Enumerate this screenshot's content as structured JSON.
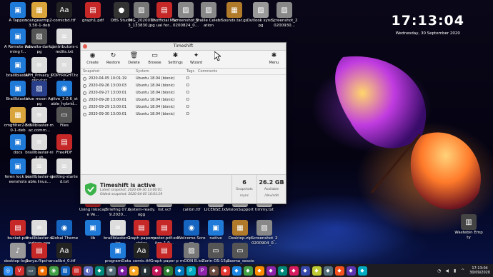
{
  "clock": {
    "time": "17:13:04",
    "date": "Wednesday, 30 September 2020"
  },
  "desktop_icons": [
    {
      "label": "A Tappon",
      "color": "#1f7ad8",
      "glyph": "▣"
    },
    {
      "label": "scangearmp2-3.50-1-deb",
      "color": "#d9a43c",
      "glyph": "▦"
    },
    {
      "label": "comicbd.ttf",
      "color": "#222",
      "glyph": "Aa"
    },
    {
      "label": "graph1.pdf",
      "color": "#c62828",
      "glyph": "▤"
    },
    {
      "label": "OBS Studio",
      "color": "#333",
      "glyph": "●"
    },
    {
      "label": "IMG_20200703_133830.jpg",
      "color": "#777",
      "glyph": "▨"
    },
    {
      "label": "Unofficial Manual for...",
      "color": "#c62828",
      "glyph": "▤"
    },
    {
      "label": "Screenshot_20200824_0...",
      "color": "#888",
      "glyph": "▨"
    },
    {
      "label": "Braille Celebration",
      "color": "#888",
      "glyph": "▨"
    },
    {
      "label": "Sounds.tar.gz",
      "color": "#b07a2a",
      "glyph": "▦"
    },
    {
      "label": "Outlook sync.jpg",
      "color": "#999",
      "glyph": "▨"
    },
    {
      "label": "Screenshot_20200930...",
      "color": "#888",
      "glyph": "▨"
    },
    {
      "label": "A Remote Learning f...",
      "color": "#1f7ad8",
      "glyph": "▣"
    },
    {
      "label": "Adwaita-dark.jpg",
      "color": "#555",
      "glyph": "▨"
    },
    {
      "label": "contributors-credits.txt",
      "color": "#ddd",
      "glyph": "≡"
    },
    {
      "label": "braillblaster",
      "color": "#1f7ad8",
      "glyph": "▣"
    },
    {
      "label": "APH_Privacy_Policy.txt",
      "color": "#ddd",
      "glyph": "≡"
    },
    {
      "label": "COPYRIGHT.txt",
      "color": "#ddd",
      "glyph": "≡"
    },
    {
      "label": "Braillblaster",
      "color": "#1f7ad8",
      "glyph": "▣"
    },
    {
      "label": "blue moon A.jpg",
      "color": "#2a3f8a",
      "glyph": "▨"
    },
    {
      "label": "elive_3.0.6_stable_hybrid...",
      "color": "#1f7ad8",
      "glyph": "◉"
    },
    {
      "label": "cmgfilter2-5.50-1-deb",
      "color": "#d9a43c",
      "glyph": "▦"
    },
    {
      "label": "braillblaster-mac.comm...",
      "color": "#ddd",
      "glyph": "≡"
    },
    {
      "label": "Files",
      "color": "#555",
      "glyph": "▭"
    },
    {
      "label": "docs",
      "color": "#1f7ad8",
      "glyph": "▣"
    },
    {
      "label": "braillblaster-nix.sh",
      "color": "#ddd",
      "glyph": "≡"
    },
    {
      "label": "FreePDF",
      "color": "#c62828",
      "glyph": "▤"
    },
    {
      "label": "feren lock screenshots",
      "color": "#1f7ad8",
      "glyph": "▣"
    },
    {
      "label": "braillblaster-stable.linux...",
      "color": "#ddd",
      "glyph": "≡"
    },
    {
      "label": "getting-started.txt",
      "color": "#ddd",
      "glyph": "≡"
    },
    {
      "label": "bucket.pdf",
      "color": "#c62828",
      "glyph": "▤"
    },
    {
      "label": "braillblaster-windows.exe",
      "color": "#ddd",
      "glyph": "≡"
    },
    {
      "label": "Global Theme",
      "color": "#1565c0",
      "glyph": "◉"
    },
    {
      "label": "lib",
      "color": "#1f7ad8",
      "glyph": "▣"
    },
    {
      "label": "braillblaster-1.jar",
      "color": "#ddd",
      "glyph": "≡"
    },
    {
      "label": "Graph paper printer",
      "color": "#c62828",
      "glyph": "▤"
    },
    {
      "label": "master-pdf-editor_1.9...",
      "color": "#c62828",
      "glyph": "▤"
    },
    {
      "label": "Welcome Screen",
      "color": "#1565c0",
      "glyph": "◉"
    },
    {
      "label": "native",
      "color": "#1f7ad8",
      "glyph": "▣"
    },
    {
      "label": "Desktop.zip",
      "color": "#b07a2a",
      "glyph": "▦"
    },
    {
      "label": "Screenshot_20200904_0...",
      "color": "#888",
      "glyph": "▨"
    },
    {
      "label": "desktop-login.ogg",
      "color": "#999",
      "glyph": "♪"
    },
    {
      "label": "Surya.flipchart",
      "color": "#c62828",
      "glyph": "▤"
    },
    {
      "label": "calibri_0.ttf",
      "color": "#222",
      "glyph": "Aa"
    },
    {
      "label": "Wastebin Empty",
      "color": "#444",
      "glyph": "▥"
    },
    {
      "label": "programData",
      "color": "#1f7ad8",
      "glyph": "▣"
    },
    {
      "label": "comic.ttf",
      "color": "#222",
      "glyph": "Aa"
    },
    {
      "label": "Graph paper printer link",
      "color": "#c62828",
      "glyph": "▤"
    },
    {
      "label": "mOON B.icf",
      "color": "#777",
      "glyph": "▨"
    },
    {
      "label": "Zorin-OS-15.2-Co...",
      "color": "#555",
      "glyph": "▭"
    },
    {
      "label": "plasma_session-20200828...",
      "color": "#555",
      "glyph": "▭"
    },
    {
      "label": "Using Inkscape Ve...",
      "color": "#c62828",
      "glyph": "▤"
    },
    {
      "label": "Briefing 07.09.2020...",
      "color": "#999",
      "glyph": "♪"
    },
    {
      "label": "system-ready.ogg",
      "color": "#999",
      "glyph": "♪"
    },
    {
      "label": "list.vcf",
      "color": "#ddd",
      "glyph": "≡"
    },
    {
      "label": "calibri.ttf",
      "color": "#222",
      "glyph": "Aa"
    },
    {
      "label": "LICENSE.txt",
      "color": "#ddd",
      "glyph": "≡"
    },
    {
      "label": "VisionSupport",
      "color": "#ddd",
      "glyph": "≡"
    },
    {
      "label": "timmy.txt",
      "color": "#ddd",
      "glyph": "≡"
    },
    {
      "label": "THE BIG GEOGRAPH...",
      "color": "#c62828",
      "glyph": "▤"
    },
    {
      "label": "Screenshot_20200904_0...",
      "color": "#888",
      "glyph": "▨"
    },
    {
      "label": "desktop-login.ogg",
      "color": "#999",
      "glyph": "♪"
    },
    {
      "label": "Screenshot_20200923_1...",
      "color": "#888",
      "glyph": "▨"
    },
    {
      "label": "calibri.ttf",
      "color": "#222",
      "glyph": "Aa"
    }
  ],
  "window": {
    "title": "Timeshift",
    "toolbar": [
      {
        "label": "Create",
        "icon": "create-icon",
        "glyph": "◉"
      },
      {
        "label": "Restore",
        "icon": "restore-icon",
        "glyph": "↻"
      },
      {
        "label": "Delete",
        "icon": "delete-icon",
        "glyph": "🗑"
      },
      {
        "label": "Browse",
        "icon": "folder-icon",
        "glyph": "▭"
      },
      {
        "label": "Settings",
        "icon": "settings-icon",
        "glyph": "✱"
      },
      {
        "label": "Wizard",
        "icon": "wizard-icon",
        "glyph": "✦"
      }
    ],
    "menu_label": "Menu",
    "columns": {
      "snapshot": "Snapshot",
      "system": "System",
      "tags": "Tags",
      "comments": "Comments"
    },
    "snapshots": [
      {
        "date": "2020-04-05 10:01:19",
        "system": "Ubuntu 18.04 (bionic)",
        "tags": "D"
      },
      {
        "date": "2020-09-26 13:00:03",
        "system": "Ubuntu 18.04 (bionic)",
        "tags": "D"
      },
      {
        "date": "2020-09-27 13:00:01",
        "system": "Ubuntu 18.04 (bionic)",
        "tags": "D"
      },
      {
        "date": "2020-09-28 13:00:01",
        "system": "Ubuntu 18.04 (bionic)",
        "tags": "D"
      },
      {
        "date": "2020-09-29 13:00:01",
        "system": "Ubuntu 18.04 (bionic)",
        "tags": "D"
      },
      {
        "date": "2020-09-30 13:00:01",
        "system": "Ubuntu 18.04 (bionic)",
        "tags": "D"
      }
    ],
    "status": {
      "heading": "Timeshift is active",
      "latest": "Latest snapshot: 2020-09-30 13:00:01",
      "oldest": "Oldest snapshot: 2020-04-05 10:01:19",
      "count": "6",
      "count_label": "Snapshots",
      "count_sub": "rsync",
      "size": "26.2 GB",
      "size_label": "Available",
      "size_sub": "/dev/sdd"
    }
  },
  "taskbar": {
    "time": "17:13:04",
    "date": "30/09/2020",
    "apps": [
      {
        "name": "menu-icon",
        "color": "#2d8cf0",
        "glyph": "◎"
      },
      {
        "name": "vivaldi-icon",
        "color": "#d32f2f",
        "glyph": "V"
      },
      {
        "name": "files-icon",
        "color": "#455a64",
        "glyph": "▭"
      },
      {
        "name": "firefox-icon",
        "color": "#ef6c00",
        "glyph": "◉"
      },
      {
        "name": "chrome-icon",
        "color": "#43a047",
        "glyph": "◉"
      },
      {
        "name": "image-viewer-icon",
        "color": "#1565c0",
        "glyph": "▨"
      },
      {
        "name": "pdf-icon",
        "color": "#c62828",
        "glyph": "▤"
      },
      {
        "name": "discord-icon",
        "color": "#5c6bc0",
        "glyph": "◐"
      },
      {
        "name": "app-icon",
        "color": "#00897b",
        "glyph": "◆"
      },
      {
        "name": "settings-icon",
        "color": "#546e7a",
        "glyph": "✱"
      },
      {
        "name": "app-icon",
        "color": "#7b1fa2",
        "glyph": "◆"
      },
      {
        "name": "app-icon",
        "color": "#f9a825",
        "glyph": "◆"
      },
      {
        "name": "terminal-icon",
        "color": "#263238",
        "glyph": "▮"
      },
      {
        "name": "app-icon",
        "color": "#c2185b",
        "glyph": "◆"
      },
      {
        "name": "app-icon",
        "color": "#2e7d32",
        "glyph": "◆"
      },
      {
        "name": "app-icon",
        "color": "#0277bd",
        "glyph": "◆"
      },
      {
        "name": "pycharm-icon",
        "color": "#00acc1",
        "glyph": "P"
      },
      {
        "name": "pycharm-icon",
        "color": "#8e24aa",
        "glyph": "P"
      },
      {
        "name": "app-icon",
        "color": "#6d4c41",
        "glyph": "◆"
      },
      {
        "name": "app-icon",
        "color": "#e53935",
        "glyph": "◆"
      },
      {
        "name": "app-icon",
        "color": "#1e88e5",
        "glyph": "◆"
      },
      {
        "name": "app-icon",
        "color": "#43a047",
        "glyph": "◆"
      },
      {
        "name": "app-icon",
        "color": "#fb8c00",
        "glyph": "◆"
      },
      {
        "name": "app-icon",
        "color": "#8e24aa",
        "glyph": "◆"
      },
      {
        "name": "app-icon",
        "color": "#00897b",
        "glyph": "◆"
      },
      {
        "name": "app-icon",
        "color": "#d81b60",
        "glyph": "◆"
      },
      {
        "name": "app-icon",
        "color": "#3949ab",
        "glyph": "◆"
      },
      {
        "name": "app-icon",
        "color": "#c0ca33",
        "glyph": "◆"
      },
      {
        "name": "app-icon",
        "color": "#546e7a",
        "glyph": "◆"
      },
      {
        "name": "app-icon",
        "color": "#f4511e",
        "glyph": "◆"
      },
      {
        "name": "app-icon",
        "color": "#5e35b1",
        "glyph": "◆"
      },
      {
        "name": "app-icon",
        "color": "#00acc1",
        "glyph": "◆"
      }
    ]
  }
}
